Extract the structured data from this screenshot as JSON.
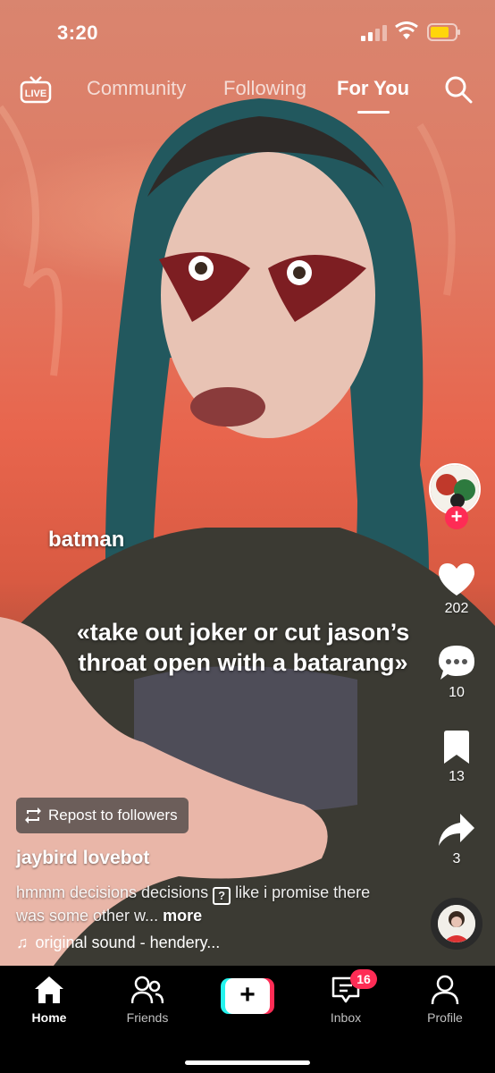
{
  "status_bar": {
    "time": "3:20"
  },
  "top_nav": {
    "live_label": "LIVE",
    "tabs": [
      {
        "label": "Community"
      },
      {
        "label": "Following"
      },
      {
        "label": "For You"
      }
    ],
    "active_tab": "For You"
  },
  "video": {
    "caption_label": "batman",
    "caption_quote": "«take out joker or cut jason’s throat open with a batarang»"
  },
  "rail": {
    "likes": "202",
    "comments": "10",
    "saves": "13",
    "shares": "3",
    "follow_symbol": "+"
  },
  "post": {
    "repost_label": "Repost to followers",
    "username": "jaybird lovebot",
    "description_start": "hmmm decisions decisions ",
    "description_emoji": "?",
    "description_end": " like i promise there was some other w... ",
    "more_label": "more",
    "sound": "original sound - hendery..."
  },
  "tab_bar": {
    "items": [
      {
        "label": "Home"
      },
      {
        "label": "Friends"
      },
      {
        "label": "+"
      },
      {
        "label": "Inbox"
      },
      {
        "label": "Profile"
      }
    ],
    "inbox_badge": "16",
    "active": "Home"
  },
  "colors": {
    "accent_red": "#fe2c55",
    "accent_cyan": "#25f4ee"
  }
}
